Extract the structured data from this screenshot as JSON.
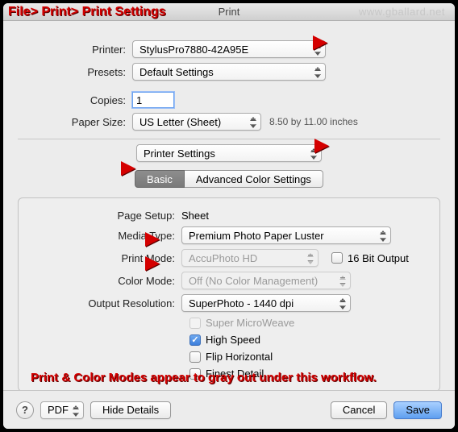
{
  "title": "Print",
  "watermark": "www.gballard.net",
  "labels": {
    "printer": "Printer:",
    "presets": "Presets:",
    "copies": "Copies:",
    "paper_size": "Paper Size:",
    "page_setup": "Page Setup:",
    "media_type": "Media Type:",
    "print_mode": "Print Mode:",
    "color_mode": "Color Mode:",
    "output_resolution": "Output Resolution:"
  },
  "values": {
    "printer": "StylusPro7880-42A95E",
    "presets": "Default Settings",
    "copies": "1",
    "paper_size": "US Letter (Sheet)",
    "paper_hint": "8.50 by 11.00 inches",
    "panel": "Printer Settings",
    "page_setup": "Sheet",
    "media_type": "Premium Photo Paper Luster",
    "print_mode": "AccuPhoto HD",
    "color_mode": "Off (No Color Management)",
    "output_resolution": "SuperPhoto - 1440 dpi"
  },
  "tabs": {
    "basic": "Basic",
    "advanced": "Advanced Color Settings",
    "active": "basic"
  },
  "options": {
    "sixteen_bit": {
      "label": "16 Bit Output",
      "checked": false
    },
    "super_microweave": {
      "label": "Super MicroWeave",
      "checked": false,
      "disabled": true
    },
    "high_speed": {
      "label": "High Speed",
      "checked": true
    },
    "flip_horizontal": {
      "label": "Flip Horizontal",
      "checked": false
    },
    "finest_detail": {
      "label": "Finest Detail",
      "checked": false
    }
  },
  "footer": {
    "help": "?",
    "pdf": "PDF",
    "hide_details": "Hide Details",
    "cancel": "Cancel",
    "save": "Save"
  },
  "annotations": {
    "breadcrumb": "File> Print> Print Settings",
    "bottom": "Print & Color Modes appear to gray out under this workflow."
  }
}
